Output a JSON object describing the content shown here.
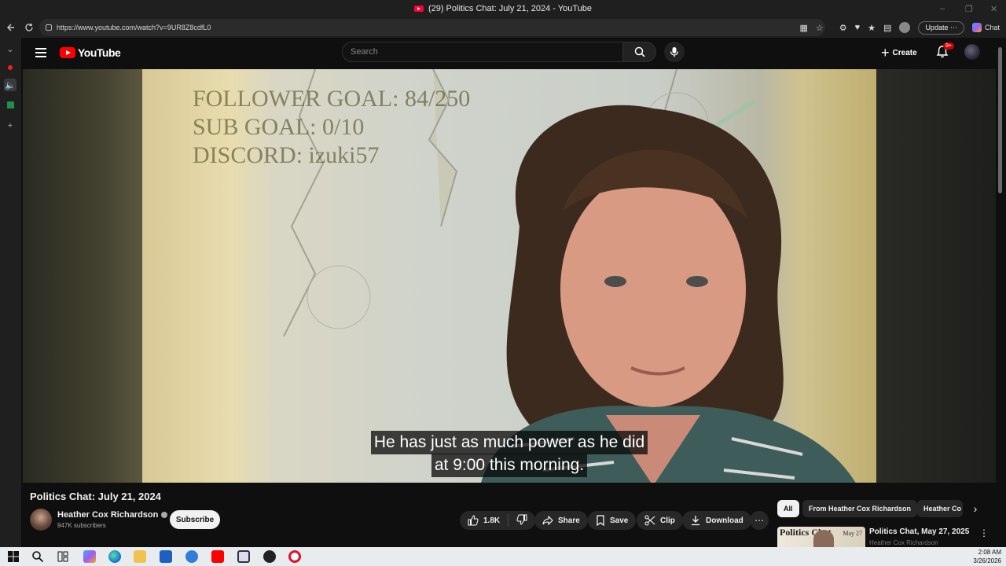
{
  "window": {
    "title": "(29) Politics Chat: July 21, 2024 - YouTube",
    "controls": [
      "–",
      "❐",
      "✕"
    ]
  },
  "browser": {
    "url": "https://www.youtube.com/watch?v=9UR8Z8cdfL0",
    "update_label": "Update",
    "update_more": "⋯",
    "chat_label": "Chat"
  },
  "youtube": {
    "logo_text": "YouTube",
    "search_placeholder": "Search",
    "create_label": "Create",
    "notifications_badge": "9+"
  },
  "video": {
    "overlay_lines": [
      "FOLLOWER GOAL: 84/250",
      "SUB GOAL: 0/10",
      "DISCORD: izuki57"
    ],
    "caption_line1": "He has just as much power as he did",
    "caption_line2": "at 9:00 this morning.",
    "title": "Politics Chat: July 21, 2024"
  },
  "channel": {
    "name": "Heather Cox Richardson",
    "subscribers": "947K subscribers",
    "subscribe_label": "Subscribe"
  },
  "actions": {
    "likes": "1.8K",
    "share": "Share",
    "save": "Save",
    "clip": "Clip",
    "download": "Download"
  },
  "chips": [
    "All",
    "From Heather Cox Richardson",
    "Heather Co"
  ],
  "recommendation": {
    "title": "Politics Chat, May 27, 2025",
    "channel": "Heather Cox Richardson",
    "thumb_text": "Politics Chat",
    "thumb_date": "May 27"
  },
  "taskbar": {
    "time": "2:08 AM",
    "date": "3/26/2026"
  }
}
